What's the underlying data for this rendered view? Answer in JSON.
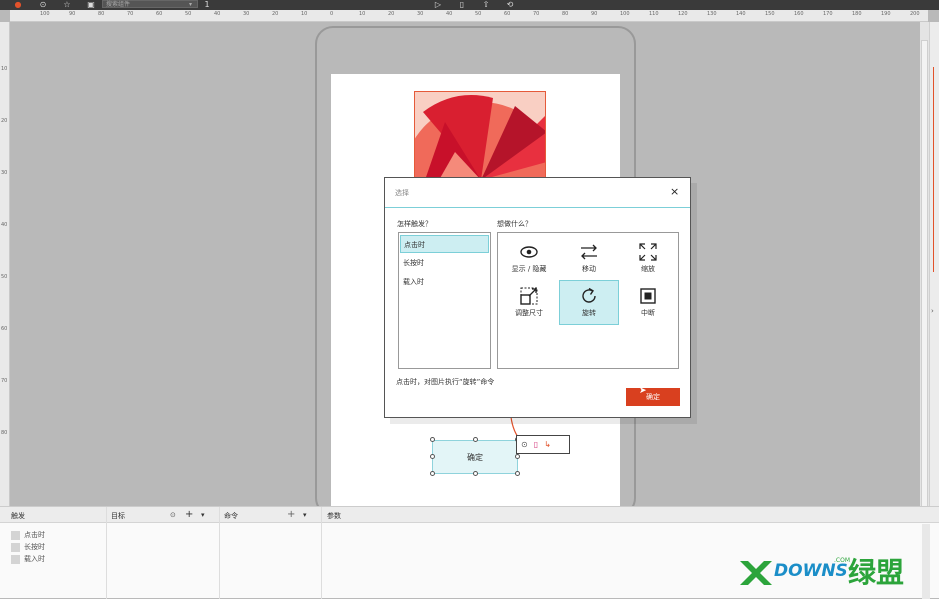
{
  "toolbar": {
    "search_placeholder": "搜索组件",
    "search_dropdown": "▾",
    "search_extra": "1"
  },
  "ruler": {
    "top_ticks": [
      "100",
      "90",
      "80",
      "70",
      "60",
      "50",
      "40",
      "30",
      "20",
      "10",
      "0",
      "10",
      "20",
      "30",
      "40",
      "50",
      "60",
      "70",
      "80",
      "90",
      "100",
      "110",
      "120",
      "130",
      "140",
      "150",
      "160",
      "170",
      "180",
      "190",
      "200"
    ],
    "left_ticks": [
      "10",
      "20",
      "30",
      "40",
      "50",
      "60",
      "70",
      "80"
    ]
  },
  "canvas": {
    "button_label": "确定"
  },
  "dialog": {
    "title": "选择",
    "close_glyph": "×",
    "trigger_label": "怎样触发？",
    "action_label": "想做什么？",
    "triggers": [
      {
        "label": "点击时",
        "selected": true
      },
      {
        "label": "长按时",
        "selected": false
      },
      {
        "label": "载入时",
        "selected": false
      }
    ],
    "actions": [
      {
        "label": "显示 / 隐藏",
        "icon": "eye-icon",
        "selected": false
      },
      {
        "label": "移动",
        "icon": "move-arrows-icon",
        "selected": false
      },
      {
        "label": "缩放",
        "icon": "expand-icon",
        "selected": false
      },
      {
        "label": "调整尺寸",
        "icon": "resize-icon",
        "selected": false
      },
      {
        "label": "旋转",
        "icon": "rotate-icon",
        "selected": true
      },
      {
        "label": "中断",
        "icon": "stop-icon",
        "selected": false
      }
    ],
    "description": "点击时，对图片执行“旋转”命令",
    "ok_label": "确定"
  },
  "bottom_panel": {
    "col_trigger": "触发",
    "col_target": "目标",
    "col_command": "命令",
    "col_params": "参数",
    "add_glyph": "+",
    "dropdown_glyph": "▾",
    "triggers": [
      "点击时",
      "长按时",
      "载入时"
    ]
  },
  "watermark": {
    "brand_en": "DOWNS",
    "brand_cn": "绿盟",
    "brand_com": ".COM"
  },
  "colors": {
    "accent": "#4fc0cf",
    "primary_button": "#d9401f",
    "selection": "#cdeef2"
  }
}
